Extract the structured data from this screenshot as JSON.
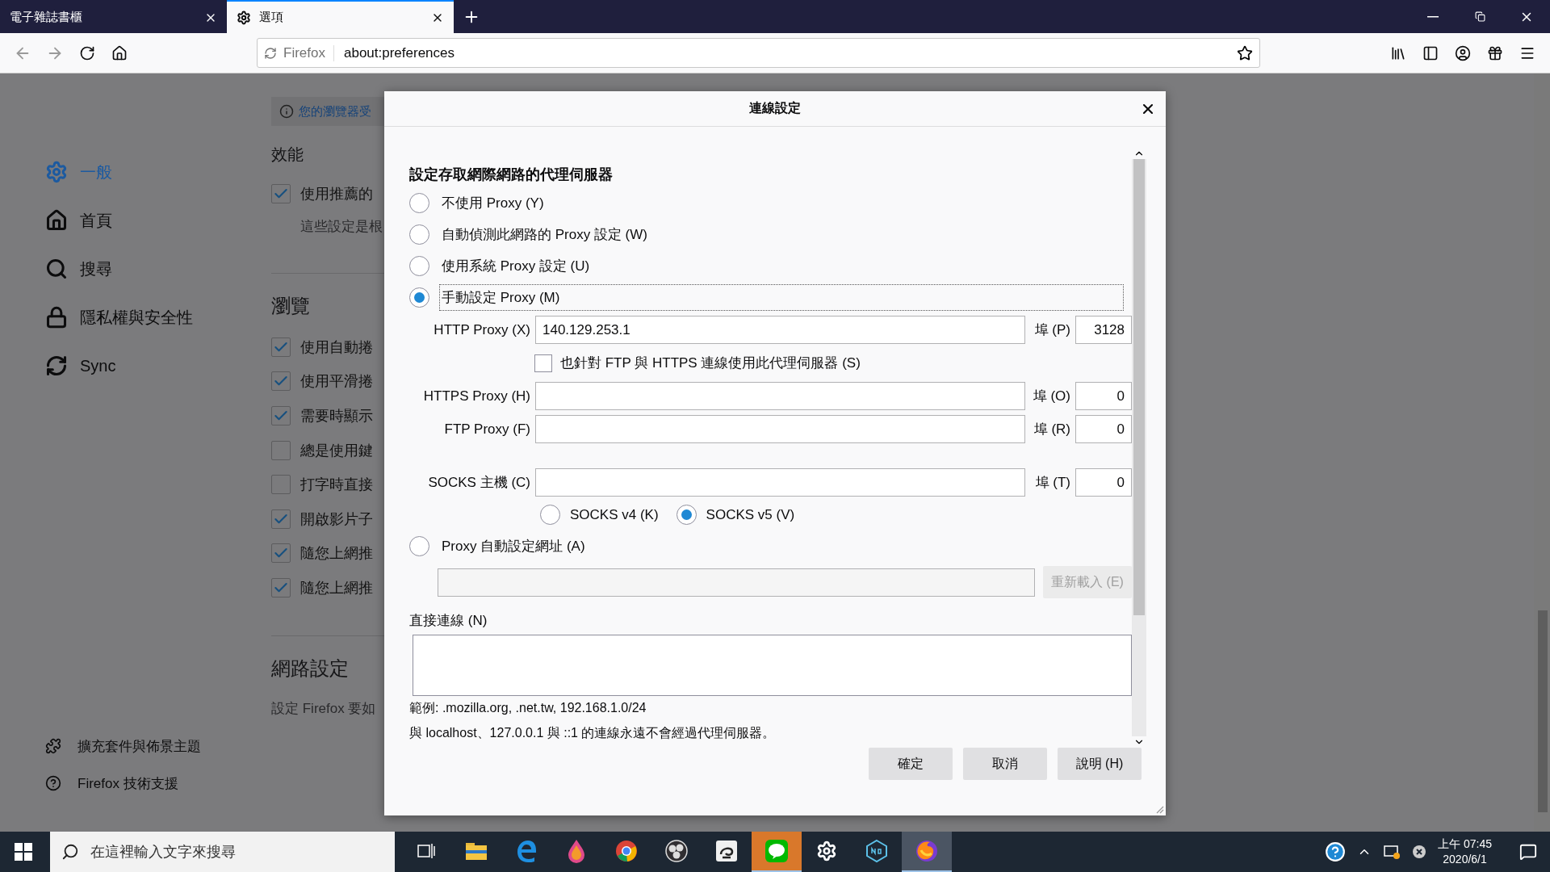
{
  "browser": {
    "tabs": [
      {
        "label": "電子雜誌書櫃",
        "selected": false
      },
      {
        "label": "選項",
        "selected": true
      }
    ],
    "url_identity": "Firefox",
    "url": "about:preferences"
  },
  "sidebar": {
    "items": [
      {
        "label": "一般",
        "selected": true
      },
      {
        "label": "首頁",
        "selected": false
      },
      {
        "label": "搜尋",
        "selected": false
      },
      {
        "label": "隱私權與安全性",
        "selected": false
      },
      {
        "label": "Sync",
        "selected": false
      }
    ],
    "footer_links": [
      "擴充套件與佈景主題",
      "Firefox 技術支援"
    ]
  },
  "preferences": {
    "notice": "您的瀏覽器受",
    "sections": [
      {
        "heading": "效能",
        "rows": [
          {
            "kind": "checkbox",
            "label": "使用推薦的",
            "checked": true
          },
          {
            "kind": "note",
            "label": "這些設定是根"
          }
        ]
      },
      {
        "heading": "瀏覽",
        "rows": [
          {
            "kind": "checkbox",
            "label": "使用自動捲",
            "checked": true
          },
          {
            "kind": "checkbox",
            "label": "使用平滑捲",
            "checked": true
          },
          {
            "kind": "checkbox",
            "label": "需要時顯示",
            "checked": true
          },
          {
            "kind": "checkbox",
            "label": "總是使用鍵",
            "checked": false
          },
          {
            "kind": "checkbox",
            "label": "打字時直接",
            "checked": false
          },
          {
            "kind": "checkbox",
            "label": "開啟影片子",
            "checked": true
          },
          {
            "kind": "checkbox",
            "label": "隨您上網推",
            "checked": true
          },
          {
            "kind": "checkbox",
            "label": "隨您上網推",
            "checked": true
          }
        ]
      },
      {
        "heading": "網路設定",
        "rows": [
          {
            "kind": "note",
            "label": "設定 Firefox 要如"
          }
        ]
      }
    ]
  },
  "dialog": {
    "title": "連線設定",
    "heading": "設定存取網際網路的代理伺服器",
    "proxy_modes": [
      {
        "label": "不使用 Proxy (Y)",
        "selected": false
      },
      {
        "label": "自動偵測此網路的 Proxy 設定 (W)",
        "selected": false
      },
      {
        "label": "使用系統 Proxy 設定 (U)",
        "selected": false
      },
      {
        "label": "手動設定 Proxy (M)",
        "selected": true
      }
    ],
    "manual": {
      "http": {
        "label": "HTTP Proxy (X)",
        "value": "140.129.253.1",
        "port_label": "埠 (P)",
        "port": "3128"
      },
      "share_option": {
        "label": "也針對 FTP 與 HTTPS 連線使用此代理伺服器 (S)",
        "checked": false
      },
      "others": [
        {
          "label": "HTTPS Proxy (H)",
          "port_label": "埠 (O)",
          "port": "0"
        },
        {
          "label": "FTP Proxy (F)",
          "port_label": "埠 (R)",
          "port": "0"
        }
      ],
      "socks": {
        "label": "SOCKS 主機 (C)",
        "port_label": "埠 (T)",
        "port": "0"
      },
      "socks_versions": [
        {
          "label": "SOCKS v4 (K)",
          "selected": false
        },
        {
          "label": "SOCKS v5 (V)",
          "selected": true
        }
      ]
    },
    "auto_config": {
      "label": "Proxy 自動設定網址 (A)",
      "selected": false,
      "reload_button": {
        "label": "重新載入 (E)",
        "disabled": true
      }
    },
    "no_proxy": {
      "label": "直接連線 (N)",
      "example": "範例: .mozilla.org, .net.tw, 192.168.1.0/24",
      "note": "與 localhost、127.0.0.1 與 ::1 的連線永遠不會經過代理伺服器。"
    },
    "buttons": [
      "確定",
      "取消",
      "說明 (H)"
    ]
  },
  "taskbar": {
    "search_placeholder": "在這裡輸入文字來搜尋",
    "apps": [
      {
        "selected": false,
        "flashing": false
      },
      {
        "selected": false,
        "flashing": false
      },
      {
        "selected": false,
        "flashing": false
      },
      {
        "selected": false,
        "flashing": false
      },
      {
        "selected": false,
        "flashing": false
      },
      {
        "selected": false,
        "flashing": false
      },
      {
        "selected": false,
        "flashing": true
      },
      {
        "selected": false,
        "flashing": false
      },
      {
        "selected": false,
        "flashing": false
      },
      {
        "selected": true,
        "flashing": false
      }
    ],
    "time": "上午 07:45",
    "date": "2020/6/1"
  }
}
